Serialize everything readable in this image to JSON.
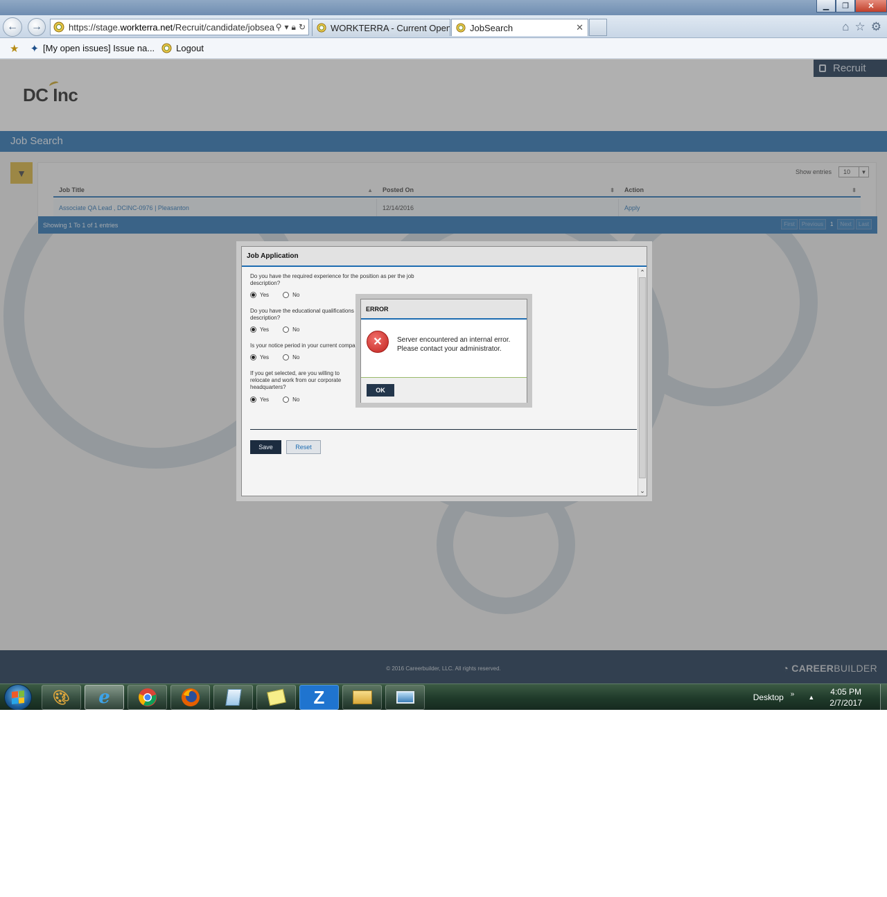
{
  "browser": {
    "address_url_prefix": "https://stage.",
    "address_url_domain": "workterra.net",
    "address_url_path": "/Recruit/candidate/jobsea",
    "tabs": [
      {
        "label": "WORKTERRA - Current Openin...",
        "active": false
      },
      {
        "label": "JobSearch",
        "active": true
      }
    ],
    "tab_close_glyph": "✕",
    "favorites": [
      {
        "label": "[My open issues] Issue na..."
      },
      {
        "label": "Logout"
      }
    ]
  },
  "header": {
    "logo_text": "DC Inc",
    "recruit_label": "Recruit"
  },
  "page": {
    "section_title": "Job Search",
    "grid": {
      "show_entries_label": "Show entries",
      "entries_value": "10",
      "columns": [
        "Job Title",
        "Posted On",
        "Action"
      ],
      "rows": [
        {
          "job_title": "Associate QA Lead , DCINC-0976 | Pleasanton",
          "posted_on": "12/14/2016",
          "action": "Apply"
        }
      ],
      "summary": "Showing 1 To 1 of 1 entries",
      "pager": [
        "First",
        "Previous",
        "1",
        "Next",
        "Last"
      ]
    },
    "footer_copyright": "© 2016 Careerbuilder, LLC. All rights reserved.",
    "footer_brand_bold": "CAREER",
    "footer_brand_thin": "BUILDER"
  },
  "job_application": {
    "title": "Job Application",
    "questions": [
      {
        "text": "Do you have the required experience for the position as per the job description?",
        "selected": "Yes"
      },
      {
        "text": "Do you have the educational qualifications a description?",
        "selected": "Yes"
      },
      {
        "text": "Is your notice period in your current compa",
        "selected": "Yes"
      },
      {
        "text": "If you get selected, are you willing to relocate and work from our corporate headquarters?",
        "selected": "Yes"
      }
    ],
    "option_yes": "Yes",
    "option_no": "No",
    "save_label": "Save",
    "reset_label": "Reset"
  },
  "error_dialog": {
    "title": "ERROR",
    "message": "Server encountered an internal error. Please contact your administrator.",
    "ok_label": "OK"
  },
  "taskbar": {
    "desktop_label": "Desktop",
    "time": "4:05 PM",
    "date": "2/7/2017",
    "apps": [
      "paint-icon",
      "internet-explorer-icon",
      "chrome-icon",
      "firefox-icon",
      "notepad-icon",
      "sticky-notes-icon",
      "zoom-icon",
      "file-explorer-icon",
      "remote-desktop-icon"
    ]
  },
  "colors": {
    "brand_blue": "#1d6cb1",
    "navy": "#0f2a47",
    "accent_gold": "#d9b133",
    "error_red": "#c0231f"
  }
}
